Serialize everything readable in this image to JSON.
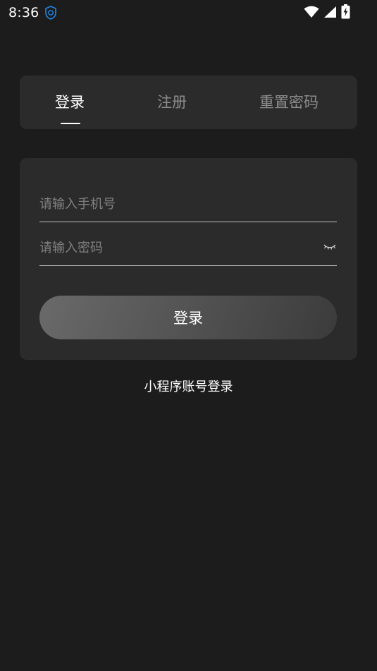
{
  "status_bar": {
    "time": "8:36",
    "icons": [
      "app-notification-icon",
      "wifi-icon",
      "cellular-signal-icon",
      "battery-charging-icon"
    ]
  },
  "tabs": [
    {
      "label": "登录",
      "active": true
    },
    {
      "label": "注册",
      "active": false
    },
    {
      "label": "重置密码",
      "active": false
    }
  ],
  "form": {
    "phone_placeholder": "请输入手机号",
    "password_placeholder": "请输入密码",
    "password_toggle_icon": "eye-closed-icon",
    "submit_label": "登录"
  },
  "mini_program_login": "小程序账号登录",
  "colors": {
    "background": "#1c1c1c",
    "card": "#2b2b2b",
    "active_tab": "#ffffff",
    "inactive_tab": "#8c8c8c",
    "placeholder": "#808080",
    "app_icon": "#1e88e5"
  }
}
